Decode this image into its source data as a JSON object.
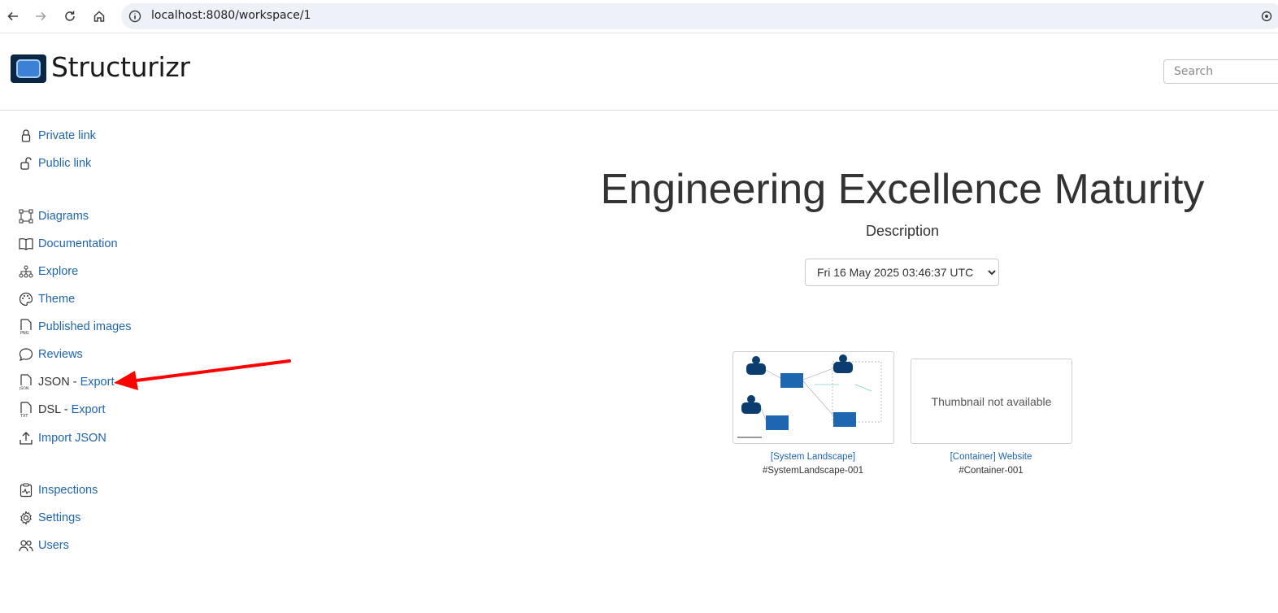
{
  "browser": {
    "url": "localhost:8080/workspace/1",
    "back_icon": "arrow-left-icon",
    "forward_icon": "arrow-right-icon",
    "reload_icon": "reload-icon",
    "home_icon": "home-icon"
  },
  "header": {
    "brand": "Structurizr",
    "search_placeholder": "Search",
    "accent": "#1f66b0"
  },
  "sidebar": {
    "private_link": "Private link",
    "public_link": "Public link",
    "diagrams": "Diagrams",
    "documentation": "Documentation",
    "explore": "Explore",
    "theme": "Theme",
    "published_images": "Published images",
    "reviews": "Reviews",
    "json_label": "JSON -",
    "json_export": "Export",
    "dsl_label": "DSL -",
    "dsl_export": "Export",
    "import_json": "Import JSON",
    "inspections": "Inspections",
    "settings": "Settings",
    "users": "Users"
  },
  "main": {
    "title": "Engineering Excellence Maturity",
    "description": "Description",
    "version_selected": "Fri 16 May 2025 03:46:37 UTC",
    "views": [
      {
        "link": "[System Landscape]",
        "key": "#SystemLandscape-001"
      },
      {
        "link": "[Container] Website",
        "key": "#Container-001",
        "thumbnail_text": "Thumbnail not available"
      }
    ]
  },
  "annotation": {
    "color": "#ff0000"
  }
}
